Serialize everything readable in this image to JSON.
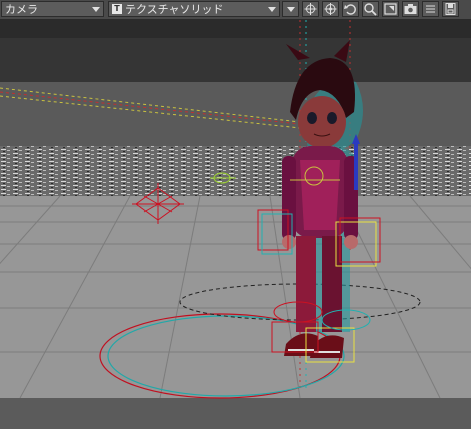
{
  "toolbar": {
    "view_select": {
      "label": "カメラ"
    },
    "render_mode_select": {
      "tag": "T",
      "label": "テクスチャソリッド"
    },
    "buttons": [
      {
        "icon": "move-view-icon"
      },
      {
        "icon": "rotate-view-icon"
      },
      {
        "icon": "undo-view-icon"
      },
      {
        "icon": "zoom-icon"
      },
      {
        "icon": "frame-view-icon"
      },
      {
        "icon": "camera-icon"
      },
      {
        "icon": "options-icon"
      },
      {
        "icon": "save-view-icon"
      }
    ]
  },
  "colors": {
    "background_top": "#353535",
    "backdrop_band": "#5a5a5a",
    "floor": "#979797",
    "floor_grid": "#7c7c7c",
    "anaglyph_red": "#cc1122",
    "anaglyph_cyan": "#22b0b0",
    "selection_yellow": "#e8e040"
  }
}
